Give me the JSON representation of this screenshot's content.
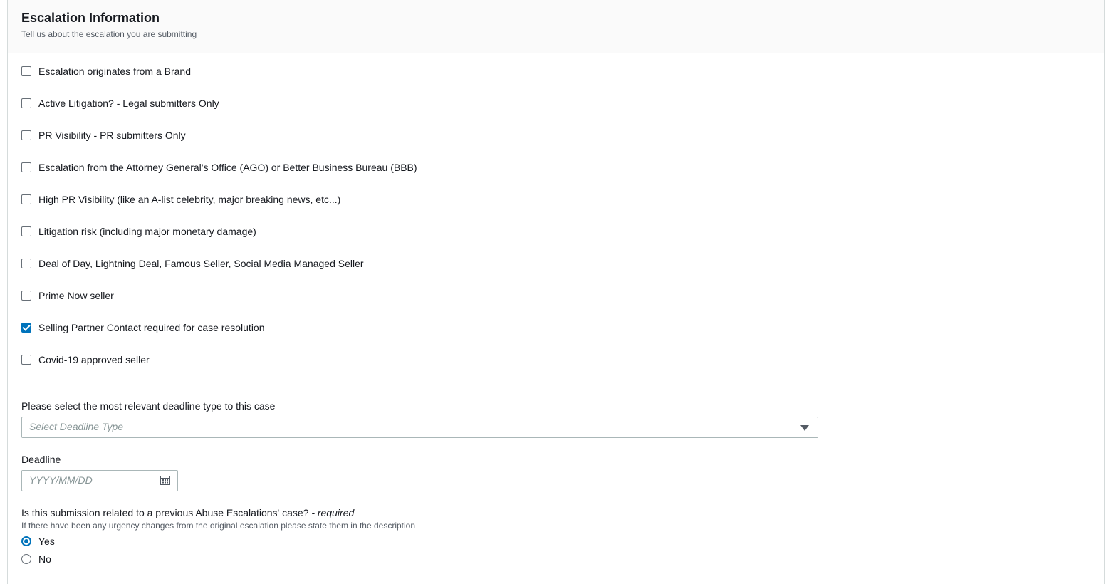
{
  "section": {
    "title": "Escalation Information",
    "subtitle": "Tell us about the escalation you are submitting"
  },
  "checkboxes": [
    {
      "label": "Escalation originates from a Brand",
      "checked": false
    },
    {
      "label": "Active Litigation? - Legal submitters Only",
      "checked": false
    },
    {
      "label": "PR Visibility - PR submitters Only",
      "checked": false
    },
    {
      "label": "Escalation from the Attorney General's Office (AGO) or Better Business Bureau (BBB)",
      "checked": false
    },
    {
      "label": "High PR Visibility (like an A-list celebrity, major breaking news, etc...)",
      "checked": false
    },
    {
      "label": "Litigation risk (including major monetary damage)",
      "checked": false
    },
    {
      "label": "Deal of Day, Lightning Deal, Famous Seller, Social Media Managed Seller",
      "checked": false
    },
    {
      "label": "Prime Now seller",
      "checked": false
    },
    {
      "label": "Selling Partner Contact required for case resolution",
      "checked": true
    },
    {
      "label": "Covid-19 approved seller",
      "checked": false
    }
  ],
  "deadline_type": {
    "label": "Please select the most relevant deadline type to this case",
    "placeholder": "Select Deadline Type"
  },
  "deadline": {
    "label": "Deadline",
    "placeholder": "YYYY/MM/DD"
  },
  "previous_case": {
    "question": "Is this submission related to a previous Abuse Escalations' case?",
    "required_text": " - required",
    "help": "If there have been any urgency changes from the original escalation please state them in the description",
    "options": [
      {
        "label": "Yes",
        "selected": true
      },
      {
        "label": "No",
        "selected": false
      }
    ]
  },
  "icons": {
    "select_caret": "caret-down-icon",
    "date_picker": "calendar-icon"
  },
  "colors": {
    "accent": "#0073bb",
    "header_bg": "#fafafa",
    "border": "#aab7b8",
    "placeholder": "#879596"
  }
}
